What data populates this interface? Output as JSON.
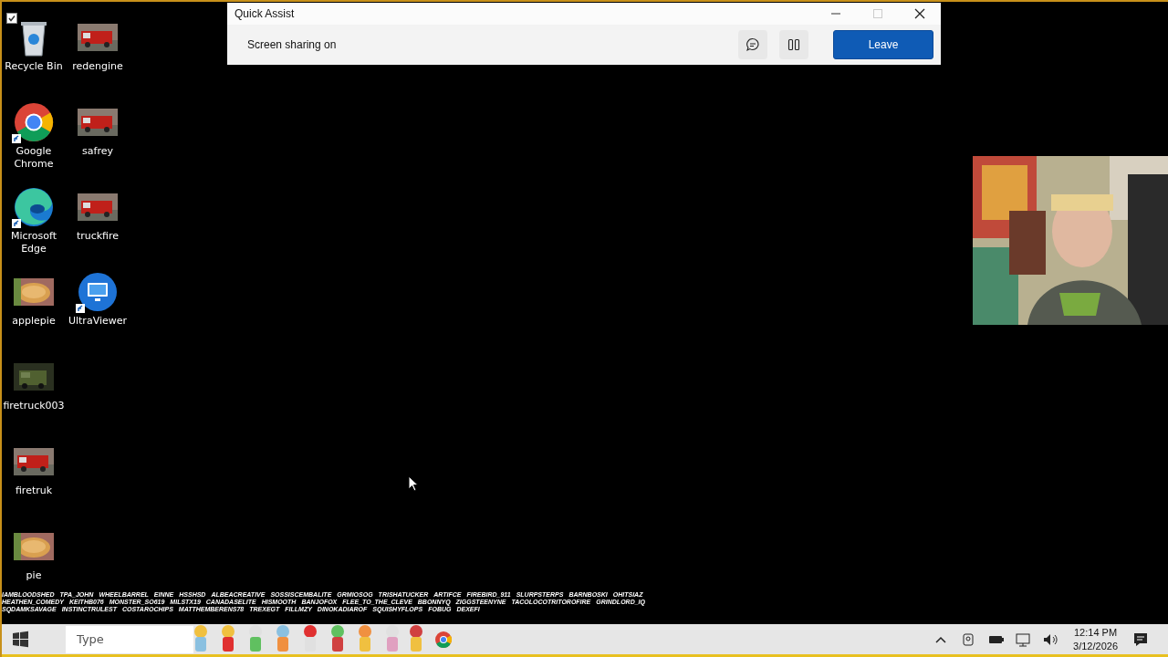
{
  "desktop_icons": [
    {
      "label": "Recycle Bin",
      "kind": "recycle",
      "checked": true,
      "shortcut": false
    },
    {
      "label": "Google Chrome",
      "kind": "chrome",
      "shortcut": true
    },
    {
      "label": "Microsoft Edge",
      "kind": "edge",
      "shortcut": true
    },
    {
      "label": "applepie",
      "kind": "picture",
      "shortcut": false
    },
    {
      "label": "firetruck003",
      "kind": "picture",
      "shortcut": false
    },
    {
      "label": "firetruk",
      "kind": "picture",
      "shortcut": false
    },
    {
      "label": "pie",
      "kind": "picture",
      "shortcut": false
    },
    {
      "label": "redengine",
      "kind": "picture",
      "shortcut": false
    },
    {
      "label": "safrey",
      "kind": "picture",
      "shortcut": false
    },
    {
      "label": "truckfire",
      "kind": "picture",
      "shortcut": false
    },
    {
      "label": "UltraViewer",
      "kind": "ultraviewer",
      "shortcut": true
    }
  ],
  "quick_assist": {
    "title": "Quick Assist",
    "status": "Screen sharing on",
    "leave_button": "Leave",
    "paused": false
  },
  "overlay_names": [
    "IAMBLOODSHED",
    "TPA_JOHN",
    "WHEELBARREL",
    "EINNE",
    "HSSHSD",
    "ALBEACREATIVE",
    "SOSSISCEMBALITE",
    "GRMIOSOG",
    "TRISHATUCKER",
    "ARTIFCE",
    "FIREBIRD_911",
    "SLURPSTERPS",
    "BARNBOSKI",
    "OHITSIAZ",
    "HEATHEN_COMEDY",
    "KEITHB076",
    "MONSTER_SO619",
    "MILSTX19",
    "CANADASELITE",
    "HISMOOTH",
    "BANJOFOX",
    "FLEE_TO_THE_CLEVE",
    "BBONNYQ",
    "ZIGGSTEENYNE",
    "TACOLOCOTRITOROFIRE",
    "GRINDLORD_IQ",
    "SQDAMKSAVAGE",
    "INSTINCTRULEST",
    "COSTAROCHIPS",
    "MATTHEMBERENS78",
    "TREXEGT",
    "FILLMZY",
    "DINOKADIAROF",
    "SQUISHYFLOPS",
    "FOBUG",
    "DEXEFI"
  ],
  "taskbar": {
    "search_text": "Type",
    "clock_time": "12:14 PM",
    "clock_date": "3/12/2026"
  }
}
